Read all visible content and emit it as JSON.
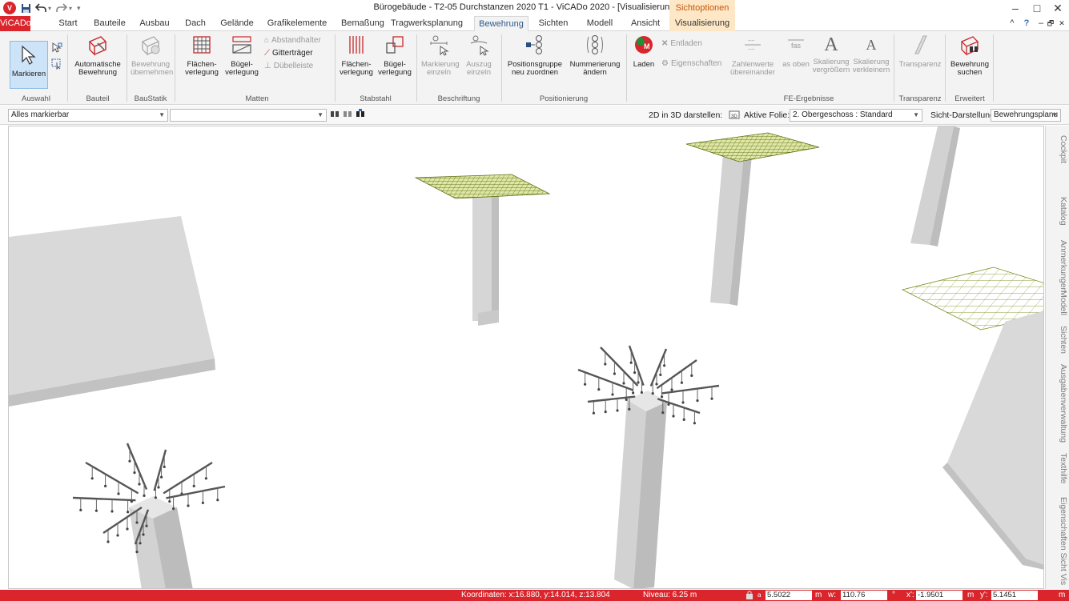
{
  "window": {
    "title": "Bürogebäude - T2-05 Durchstanzen 2020 T1 - ViCADo 2020 - [Visualisierungssicht]",
    "context_group": "Sichtoptionen",
    "logo_text": "V",
    "minimize": "–",
    "maximize": "□",
    "close": "✕"
  },
  "quick_access": {
    "save": "save-icon",
    "undo": "undo-icon",
    "redo": "redo-icon",
    "customize": "▾"
  },
  "tabs": [
    "ViCADo",
    "Start",
    "Bauteile",
    "Ausbau",
    "Dach",
    "Gelände",
    "Grafikelemente",
    "Bemaßung",
    "Tragwerksplanung",
    "Bewehrung",
    "Sichten",
    "Modell",
    "Ansicht",
    "Visualisierung"
  ],
  "active_tab": "Bewehrung",
  "ribbon_right": {
    "collapse": "^",
    "help": "?",
    "min": "–",
    "restore": "🗗",
    "close": "✕"
  },
  "ribbon": {
    "auswahl": {
      "label": "Auswahl",
      "markieren": "Markieren"
    },
    "bauteil": {
      "label": "Bauteil",
      "auto": "Automatische Bewehrung"
    },
    "baustatik": {
      "label": "BauStatik",
      "uebernehmen": "Bewehrung übernehmen"
    },
    "matten": {
      "label": "Matten",
      "flaechen": "Flächen-verlegung",
      "buegel": "Bügel-verlegung",
      "abstandhalter": "Abstandhalter",
      "gittertraeger": "Gitterträger",
      "duebelleiste": "Dübelleiste"
    },
    "stabstahl": {
      "label": "Stabstahl",
      "flaechen": "Flächen-verlegung",
      "buegel": "Bügel-verlegung"
    },
    "beschriftung": {
      "label": "Beschriftung",
      "markierung": "Markierung einzeln",
      "auszug": "Auszug einzeln"
    },
    "positionierung": {
      "label": "Positionierung",
      "gruppe": "Positionsgruppe neu zuordnen",
      "nummerierung": "Nummerierung ändern"
    },
    "fe": {
      "label": "FE-Ergebnisse",
      "laden": "Laden",
      "entladen": "Entladen",
      "eigenschaften": "Eigenschaften",
      "zahlenwerte": "Zahlenwerte übereinander",
      "as_oben": "as oben",
      "skal_gr": "Skalierung vergrößern",
      "skal_kl": "Skalierung verkleinern"
    },
    "transparenz": {
      "label": "Transparenz",
      "btn": "Transparenz"
    },
    "erweitert": {
      "label": "Erweitert",
      "suchen": "Bewehrung suchen"
    }
  },
  "filterbar": {
    "select_all": "Alles markierbar",
    "second": "",
    "d2in3d": "2D in 3D darstellen:",
    "folie_label": "Aktive Folie:",
    "folie_value": "2. Obergeschoss : Standard",
    "sicht_label": "Sicht-Darstellung:",
    "sicht_value": "Bewehrungsplanu"
  },
  "side_tabs": [
    "Cockpit",
    "Katalog",
    "Anmerkungen",
    "Modell",
    "Sichten",
    "Ausgabenverwaltung",
    "Texthilfe",
    "Eigenschaften Sicht Vis"
  ],
  "status": {
    "coords": "Koordinaten: x:16.880, y:14.014, z:13.804",
    "niveau": "Niveau: 6.25 m",
    "a_label": "a",
    "a_value": "5.5022",
    "a_unit": "m",
    "w_label": "w:",
    "w_value": "110.76",
    "w_unit": "°",
    "x_label": "x':",
    "x_value": "-1.9501",
    "x_unit": "m",
    "y_label": "y':",
    "y_value": "5.1451",
    "y_unit": "m"
  },
  "colors": {
    "brand": "#d9252b",
    "context": "#fde7c6",
    "mesh": "#7a8f1e",
    "concrete": "#d2d2d2"
  }
}
